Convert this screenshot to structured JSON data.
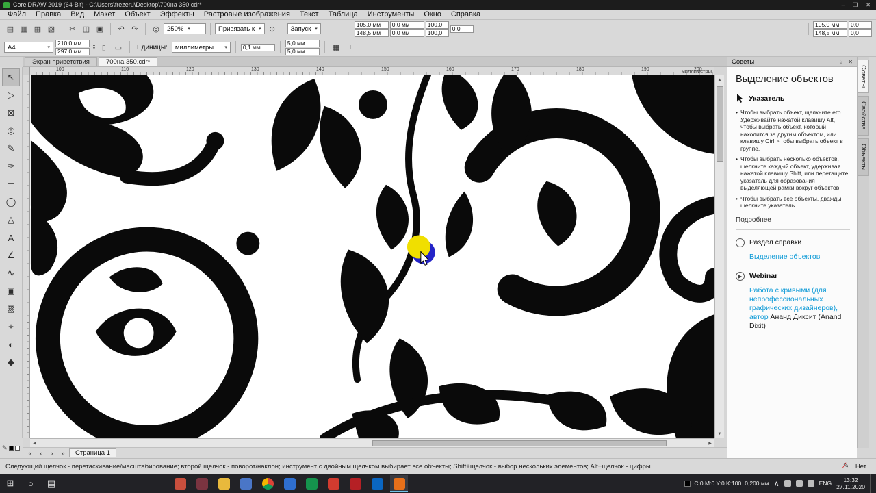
{
  "titlebar": {
    "title": "CorelDRAW 2019 (64-Bit) - C:\\Users\\frezeru\\Desktop\\700на 350.cdr*"
  },
  "glyphs": {
    "caret": "▾",
    "up": "▲",
    "down": "▼",
    "left": "◀",
    "right": "▶",
    "first": "«",
    "prev": "‹",
    "next": "›",
    "last": "»",
    "close": "✕",
    "help": "?",
    "minimize": "–",
    "restore": "❐",
    "win": "⊞",
    "search": "○",
    "taskview": "▤",
    "tray_up": "∧",
    "bullet": "•",
    "plus": "+",
    "gear": "⊕",
    "info": "i",
    "play": "▶",
    "pen": "✎",
    "slash": "∕",
    "cross": "+",
    "grid": "▦"
  },
  "menubar": {
    "items": [
      "Файл",
      "Правка",
      "Вид",
      "Макет",
      "Объект",
      "Эффекты",
      "Растровые изображения",
      "Текст",
      "Таблица",
      "Инструменты",
      "Окно",
      "Справка"
    ]
  },
  "std_icons": [
    {
      "g": "▤"
    },
    {
      "g": "▥"
    },
    {
      "g": "▦"
    },
    {
      "g": "▧"
    },
    {
      "g": "✂"
    },
    {
      "g": "◫"
    },
    {
      "g": "▣"
    },
    {
      "g": "↶"
    },
    {
      "g": "↷"
    },
    {
      "g": "◎"
    }
  ],
  "toolbar": {
    "zoom": "250%",
    "snap": "Привязать к",
    "launch": "Запуск",
    "x": "105,0 мм",
    "y": "148,5 мм",
    "w": "0,0 мм",
    "h": "0,0 мм",
    "sx": "100,0",
    "sy": "100,0",
    "angle": "0,0",
    "x2": "105,0 мм",
    "y2": "148,5 мм",
    "dx": "0,0",
    "dy": "0,0"
  },
  "propbar": {
    "preset": "A4",
    "width": "210,0 мм",
    "height": "297,0 мм",
    "portrait": "▯",
    "landscape": "▭",
    "units_label": "Единицы:",
    "units": "миллиметры",
    "nudge": "0,1 мм",
    "dup_x": "5,0 мм",
    "dup_y": "5,0 мм"
  },
  "doc_tabs": {
    "welcome": "Экран приветствия",
    "doc": "700на 350.cdr*"
  },
  "ruler": {
    "numbers": [
      "100",
      "110",
      "120",
      "130",
      "140",
      "150",
      "160",
      "170",
      "180",
      "190",
      "200"
    ],
    "units": "миллиметры"
  },
  "toolbox": {
    "tools": [
      {
        "g": "↖"
      },
      {
        "g": "▷"
      },
      {
        "g": "⊠"
      },
      {
        "g": "◎"
      },
      {
        "g": "✎"
      },
      {
        "g": "✑"
      },
      {
        "g": "▭"
      },
      {
        "g": "◯"
      },
      {
        "g": "△"
      },
      {
        "g": "A"
      },
      {
        "g": "∠"
      },
      {
        "g": "∿"
      },
      {
        "g": "▣"
      },
      {
        "g": "▨"
      },
      {
        "g": "⌖"
      },
      {
        "g": "◐"
      },
      {
        "g": "◆"
      }
    ]
  },
  "docker": {
    "header": "Советы",
    "title": "Выделение объектов",
    "tool": "Указатель",
    "bullets": [
      "Чтобы выбрать объект, щелкните его. Удерживайте нажатой клавишу Alt, чтобы выбрать объект, который находится за другим объектом, или клавишу Ctrl, чтобы выбрать объект в группе.",
      "Чтобы выбрать несколько объектов, щелкните каждый объект, удерживая нажатой клавишу Shift, или перетащите указатель для образования выделяющей рамки вокруг объектов.",
      "Чтобы выбрать все объекты, дважды щелкните указатель."
    ],
    "more": "Подробнее",
    "help_section": "Раздел справки",
    "help_link": "Выделение объектов",
    "webinar": "Webinar",
    "webinar_link": "Работа с кривыми (для непрофессиональных графических дизайнеров), автор",
    "webinar_author": "Ананд Диксит (Anand Dixit)"
  },
  "side_tabs": [
    "Советы",
    "Свойства",
    "Объекты"
  ],
  "pagenav": {
    "page": "Страница 1"
  },
  "statusbar": {
    "hint": "Следующий щелчок - перетаскивание/масштабирование; второй щелчок - поворот/наклон; инструмент с двойным щелчком выбирает все объекты; Shift+щелчок - выбор нескольких элементов; Alt+щелчок - цифры",
    "outline_none": "Нет"
  },
  "taskbar": {
    "color_info": "C:0 M:0 Y:0 K:100",
    "outline_width": "0,200 мм",
    "lang": "ENG",
    "time": "13:32",
    "date": "27.11.2020"
  },
  "colors": {
    "selection_yellow": "#f0df00",
    "selection_blue": "#2424c8",
    "link_blue": "#0f9bd7",
    "artwork_black": "#0a0a0a"
  }
}
